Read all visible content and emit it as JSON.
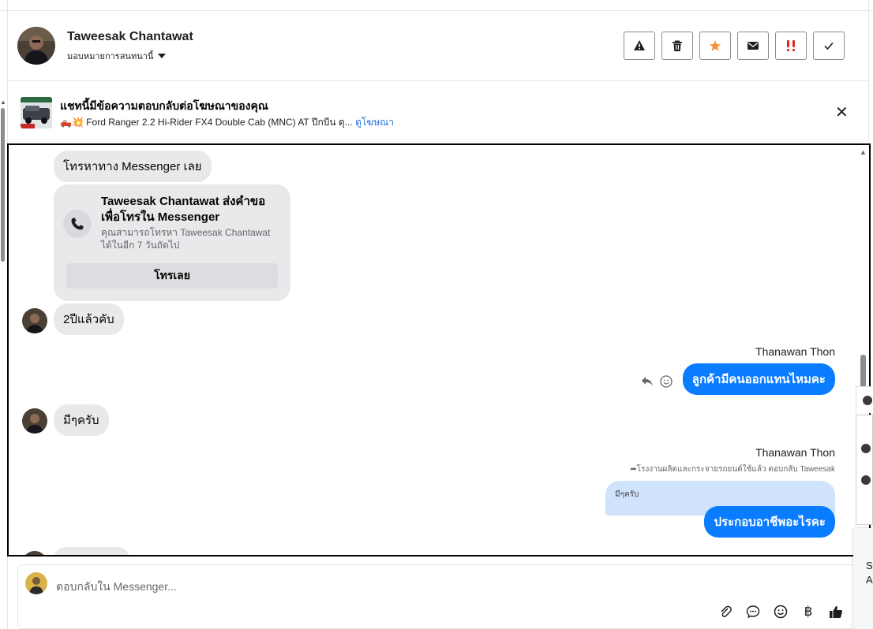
{
  "header": {
    "contact_name": "Taweesak Chantawat",
    "assign_label": "มอบหมายการสนทนานี้",
    "actions": [
      {
        "icon": "warning-icon",
        "label": "สแปม"
      },
      {
        "icon": "trash-icon",
        "label": "ลบ"
      },
      {
        "icon": "star-icon",
        "label": "ติดดาว"
      },
      {
        "icon": "envelope-icon",
        "label": "ทำเครื่องหมายว่ายังไม่ได้อ่าน"
      },
      {
        "icon": "priority-icon",
        "label": "สำคัญ"
      },
      {
        "icon": "check-icon",
        "label": "เสร็จสิ้น"
      }
    ]
  },
  "ad_banner": {
    "title": "แชทนี้มีข้อความตอบกลับต่อโฆษณาของคุณ",
    "subtitle": "🛻💥 Ford Ranger 2.2 Hi-Rider FX4 Double Cab (MNC) AT ปีกบีน ดุ...",
    "link": "ดูโฆษณา"
  },
  "messages": {
    "call_prompt": "โทรหาทาง Messenger เลย",
    "call_card_title": "Taweesak Chantawat ส่งคำขอเพื่อโทรใน Messenger",
    "call_card_desc": "คุณสามารถโทรหา Taweesak Chantawat ได้ในอีก 7 วันถัดไป",
    "call_button": "โทรเลย",
    "incoming_1": "2ปีแล้วคับ",
    "sender_1": "Thanawan Thon",
    "outgoing_1": "ลูกค้ามีคนออกแทนไหมคะ",
    "incoming_2": "มีๆครับ",
    "sender_2": "Thanawan Thon",
    "reply_note": "โรงงานผลิตและกระจายรถยนต์ใช้แล้ว ตอบกลับ Taweesak",
    "quoted_text": "มีๆครับ",
    "outgoing_2": "ประกอบอาชีพอะไรคะ"
  },
  "composer": {
    "placeholder": "ตอบกลับใน Messenger..."
  },
  "colors": {
    "bubble_out": "#0a7cff",
    "bubble_in": "#e9e9eb",
    "link": "#216fdb",
    "star": "#f7923a",
    "priority": "#e0271a"
  }
}
